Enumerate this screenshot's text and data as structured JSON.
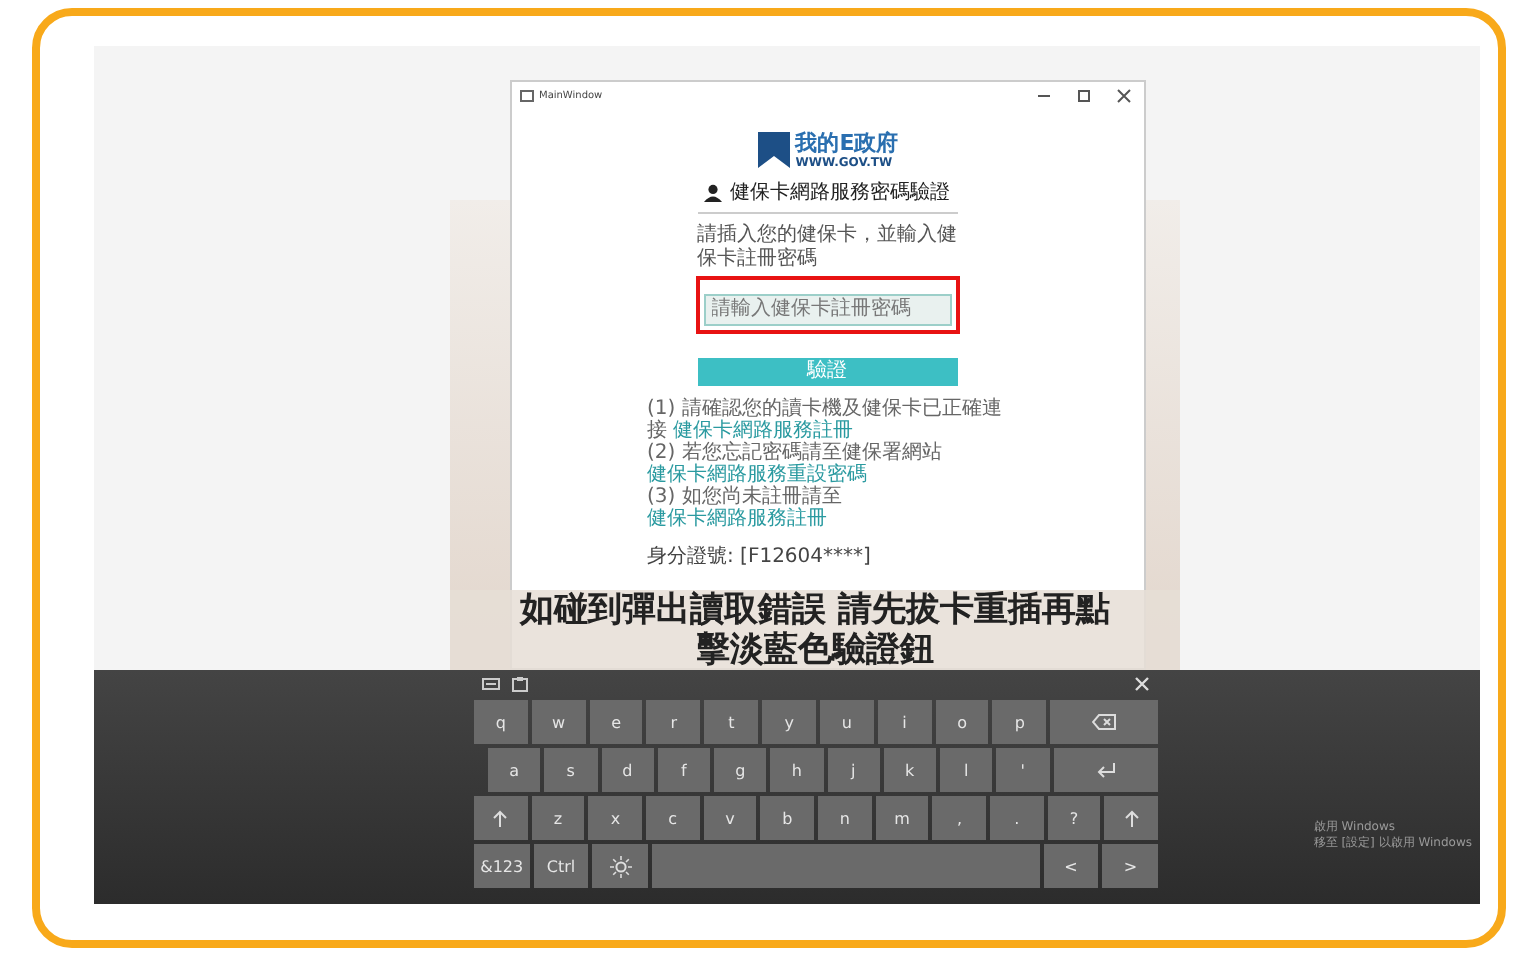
{
  "window": {
    "title": "MainWindow"
  },
  "logo": {
    "name": "我的E政府",
    "url": "WWW.GOV.TW"
  },
  "heading": "健保卡網路服務密碼驗證",
  "field": {
    "label": "請插入您的健保卡，並輸入健保卡註冊密碼",
    "placeholder": "請輸入健保卡註冊密碼",
    "highlighted": true
  },
  "verify_button": "驗證",
  "notes": [
    {
      "text": "(1) 請確認您的讀卡機及健保卡已正確連接",
      "link": "健保卡網路服務註冊"
    },
    {
      "text": "(2) 若您忘記密碼請至健保署網站",
      "link": "健保卡網路服務重設密碼"
    },
    {
      "text": "(3) 如您尚未註冊請至",
      "link": "健保卡網路服務註冊"
    }
  ],
  "id_line": "身分證號: [F12604****]",
  "caption": [
    "如碰到彈出讀取錯誤 請先拔卡重插再點",
    "擊淡藍色驗證鈕"
  ],
  "keyboard": {
    "rows": [
      [
        {
          "kind": "char",
          "label": "q"
        },
        {
          "kind": "char",
          "label": "w"
        },
        {
          "kind": "char",
          "label": "e"
        },
        {
          "kind": "char",
          "label": "r"
        },
        {
          "kind": "char",
          "label": "t"
        },
        {
          "kind": "char",
          "label": "y"
        },
        {
          "kind": "char",
          "label": "u"
        },
        {
          "kind": "char",
          "label": "i"
        },
        {
          "kind": "char",
          "label": "o"
        },
        {
          "kind": "char",
          "label": "p"
        },
        {
          "kind": "backspace"
        }
      ],
      [
        {
          "kind": "char",
          "label": "a"
        },
        {
          "kind": "char",
          "label": "s"
        },
        {
          "kind": "char",
          "label": "d"
        },
        {
          "kind": "char",
          "label": "f"
        },
        {
          "kind": "char",
          "label": "g"
        },
        {
          "kind": "char",
          "label": "h"
        },
        {
          "kind": "char",
          "label": "j"
        },
        {
          "kind": "char",
          "label": "k"
        },
        {
          "kind": "char",
          "label": "l"
        },
        {
          "kind": "char",
          "label": "'"
        },
        {
          "kind": "enter"
        }
      ],
      [
        {
          "kind": "shift"
        },
        {
          "kind": "char",
          "label": "z"
        },
        {
          "kind": "char",
          "label": "x"
        },
        {
          "kind": "char",
          "label": "c"
        },
        {
          "kind": "char",
          "label": "v"
        },
        {
          "kind": "char",
          "label": "b"
        },
        {
          "kind": "char",
          "label": "n"
        },
        {
          "kind": "char",
          "label": "m"
        },
        {
          "kind": "char",
          "label": ","
        },
        {
          "kind": "char",
          "label": "."
        },
        {
          "kind": "char",
          "label": "?"
        },
        {
          "kind": "shift"
        }
      ]
    ],
    "bottom_row": [
      {
        "kind": "char",
        "label": "&123"
      },
      {
        "kind": "char",
        "label": "Ctrl"
      },
      {
        "kind": "emoji"
      },
      {
        "kind": "space"
      },
      {
        "kind": "char",
        "label": "<"
      },
      {
        "kind": "char",
        "label": ">"
      }
    ]
  },
  "watermark": [
    "啟用 Windows",
    "移至 [設定] 以啟用 Windows"
  ]
}
